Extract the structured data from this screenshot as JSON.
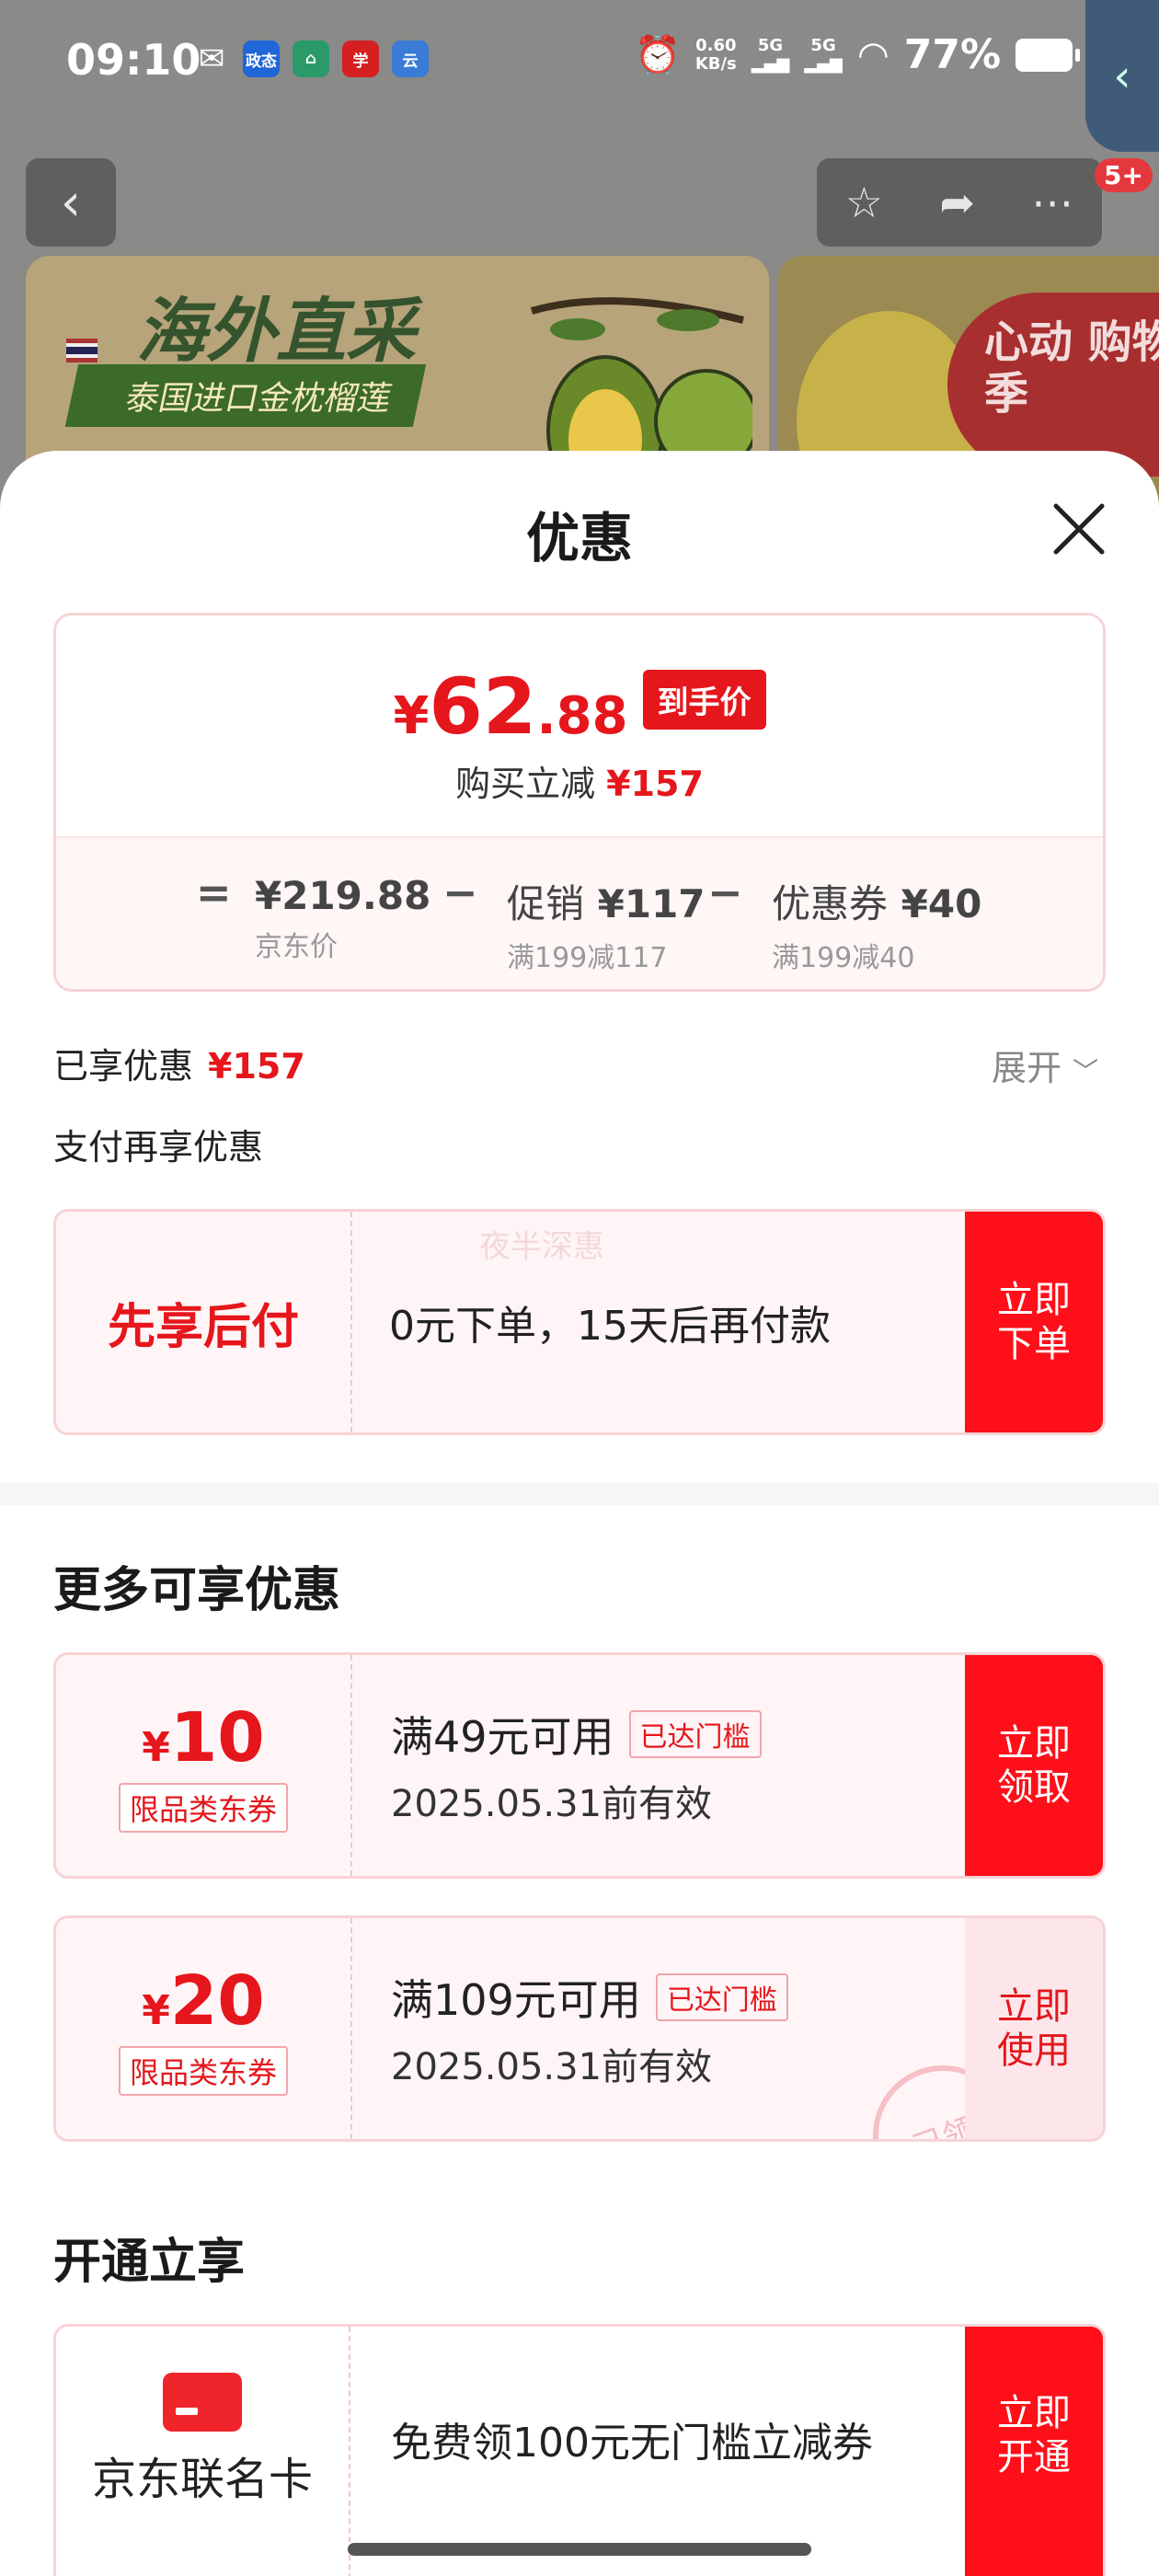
{
  "status_bar": {
    "time": "09:10",
    "apps": [
      {
        "icon": "wechat-icon",
        "text": "",
        "color": "#6b6b6b"
      },
      {
        "icon": "zhengtai-app-icon",
        "text": "政态",
        "color": "#1f66d6"
      },
      {
        "icon": "home-app-icon",
        "text": "",
        "color": "#2b9a6a"
      },
      {
        "icon": "xuexi-app-icon",
        "text": "",
        "color": "#d42020"
      },
      {
        "icon": "yun-app-icon",
        "text": "云",
        "color": "#3a7bd5"
      }
    ],
    "net_speed": "0.60",
    "net_unit": "KB/s",
    "signal1": "5G",
    "signal2": "5G",
    "battery_pct": "77%"
  },
  "background_page": {
    "badge": "5+",
    "banner_title": "海外直采",
    "banner_subtitle": "泰国进口金枕榴莲",
    "side_badge": "心动 购物季"
  },
  "sheet": {
    "title": "优惠",
    "price": {
      "currency": "¥",
      "integer": "62",
      "decimal": ".88",
      "tag": "到手价",
      "sub_label": "购买立减",
      "sub_value": "¥157"
    },
    "calc": {
      "equals": "=",
      "minus": "−",
      "base_value": "¥219.88",
      "base_note": "京东价",
      "promo_label": "促销",
      "promo_value": "¥117",
      "promo_note": "满199减117",
      "coupon_label": "优惠券",
      "coupon_value": "¥40",
      "coupon_note": "满199减40"
    },
    "enjoyed_label": "已享优惠",
    "enjoyed_value": "¥157",
    "expand_label": "展开",
    "pay_section_title": "支付再享优惠",
    "bnpl": {
      "label": "先享后付",
      "text": "0元下单，15天后再付款",
      "watermark": "夜半深惠",
      "action": "立即\n下单"
    },
    "more_title": "更多可享优惠",
    "coupons": [
      {
        "currency": "¥",
        "amount": "10",
        "type": "限品类东券",
        "condition": "满49元可用",
        "status": "已达门槛",
        "valid": "2025.05.31前有效",
        "action": "立即\n领取",
        "used": false
      },
      {
        "currency": "¥",
        "amount": "20",
        "type": "限品类东券",
        "condition": "满109元可用",
        "status": "已达门槛",
        "valid": "2025.05.31前有效",
        "action": "立即\n使用",
        "used": true,
        "stamp": "已领"
      }
    ],
    "open_title": "开通立享",
    "jd_card": {
      "name": "京东联名卡",
      "text": "免费领100元无门槛立减券",
      "action": "立即\n开通"
    }
  },
  "colors": {
    "accent_red": "#e5161c",
    "button_red": "#fe0f1a",
    "card_bg": "#fff5f6"
  }
}
